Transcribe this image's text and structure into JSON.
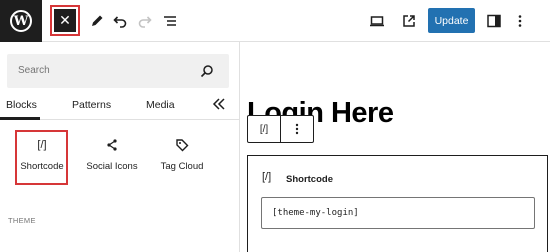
{
  "toolbar": {
    "logo_letter": "W",
    "close_glyph": "✕",
    "update_label": "Update"
  },
  "inserter": {
    "search_placeholder": "Search",
    "tabs": [
      {
        "label": "Blocks",
        "active": true
      },
      {
        "label": "Patterns",
        "active": false
      },
      {
        "label": "Media",
        "active": false
      }
    ],
    "blocks": [
      {
        "icon": "shortcode-icon",
        "icon_text": "[/]",
        "label": "Shortcode",
        "highlighted": true
      },
      {
        "icon": "share-icon",
        "label": "Social Icons"
      },
      {
        "icon": "tag-icon",
        "label": "Tag Cloud"
      }
    ],
    "section_label": "THEME"
  },
  "canvas": {
    "heading": "Login Here",
    "block_toolbar_icon": "[/]",
    "shortcode_block": {
      "icon_text": "[/]",
      "label": "Shortcode",
      "value": "[theme-my-login]"
    }
  },
  "colors": {
    "highlight": "#d63638",
    "primary": "#2271b1",
    "dark": "#1e1e1e"
  }
}
